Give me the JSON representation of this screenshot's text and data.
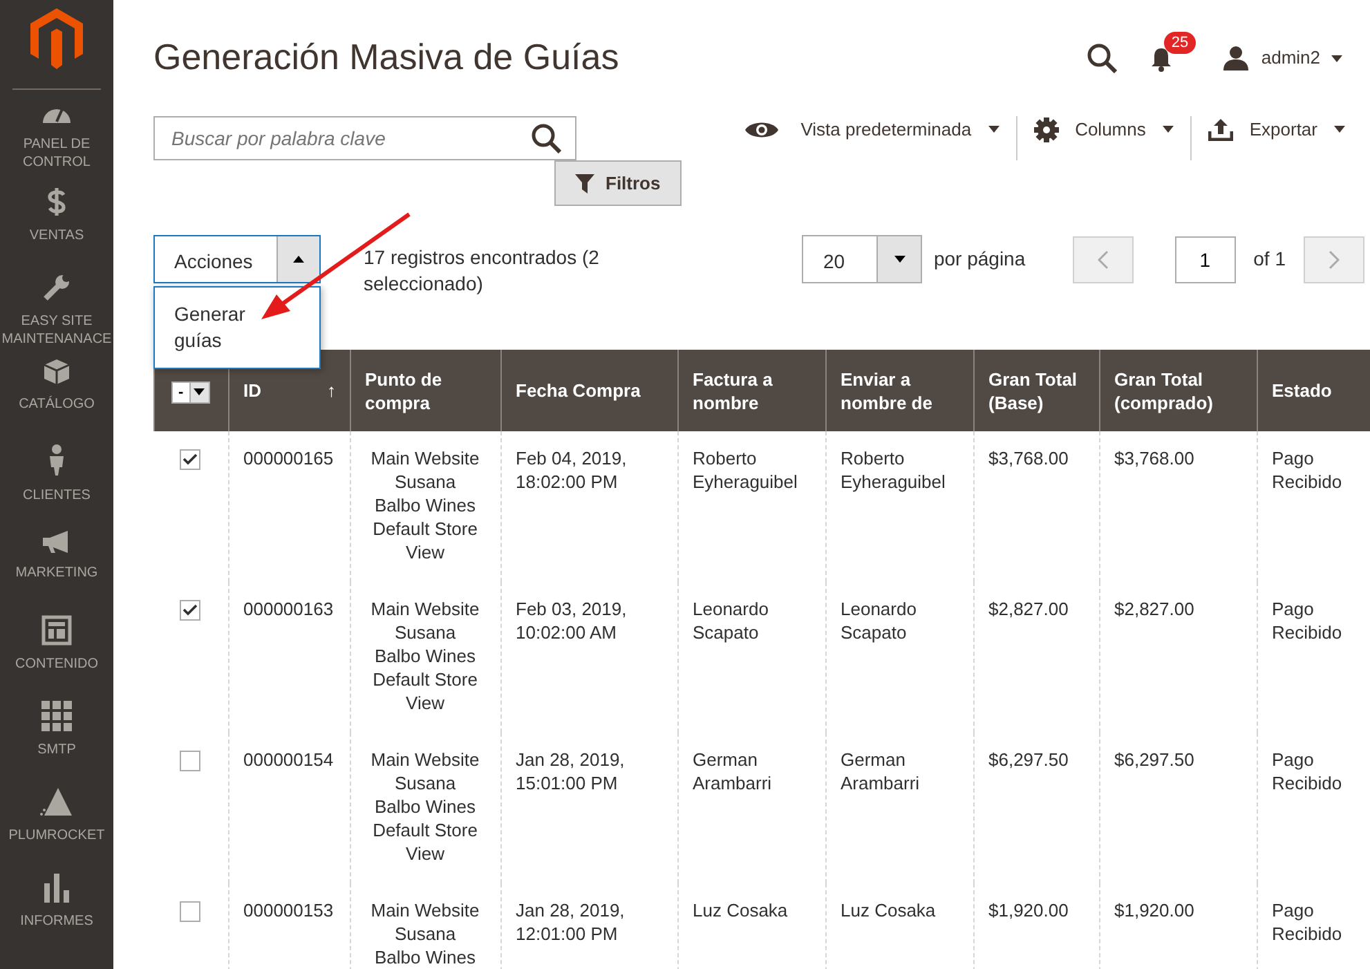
{
  "sidebar": {
    "items": [
      {
        "label": "PANEL DE CONTROL"
      },
      {
        "label": "VENTAS"
      },
      {
        "label": "EASY SITE MAINTENANACE"
      },
      {
        "label": "CATÁLOGO"
      },
      {
        "label": "CLIENTES"
      },
      {
        "label": "MARKETING"
      },
      {
        "label": "CONTENIDO"
      },
      {
        "label": "SMTP"
      },
      {
        "label": "PLUMROCKET"
      },
      {
        "label": "INFORMES"
      }
    ]
  },
  "header": {
    "title": "Generación Masiva de Guías",
    "notifications": "25",
    "user": "admin2"
  },
  "search": {
    "placeholder": "Buscar por palabra clave"
  },
  "toolbar": {
    "view": "Vista predeterminada",
    "columns": "Columns",
    "export": "Exportar",
    "filters": "Filtros"
  },
  "actions": {
    "label": "Acciones",
    "expanded": true,
    "menu": [
      "Generar guías"
    ]
  },
  "records": "17 registros encontrados (2 seleccionado)",
  "pager": {
    "per_page": "20",
    "per_page_label": "por página",
    "page": "1",
    "of": "of 1"
  },
  "table": {
    "mass_select": "-",
    "columns": [
      {
        "label": "ID",
        "sort_mark": "↑"
      },
      {
        "label": "Punto de compra"
      },
      {
        "label": "Fecha Compra"
      },
      {
        "label": "Factura a nombre"
      },
      {
        "label": "Enviar a nombre de"
      },
      {
        "label": "Gran Total (Base)"
      },
      {
        "label": "Gran Total (comprado)"
      },
      {
        "label": "Estado"
      }
    ],
    "rows": [
      {
        "selected": true,
        "cells": [
          "000000165",
          "Main Website Susana Balbo Wines Default Store View",
          "Feb 04, 2019, 18:02:00 PM",
          "Roberto Eyheraguibel",
          "Roberto Eyheraguibel",
          "$3,768.00",
          "$3,768.00",
          "Pago Recibido"
        ]
      },
      {
        "selected": true,
        "cells": [
          "000000163",
          "Main Website Susana Balbo Wines Default Store View",
          "Feb 03, 2019, 10:02:00 AM",
          "Leonardo Scapato",
          "Leonardo Scapato",
          "$2,827.00",
          "$2,827.00",
          "Pago Recibido"
        ]
      },
      {
        "selected": false,
        "cells": [
          "000000154",
          "Main Website Susana Balbo Wines Default Store View",
          "Jan 28, 2019, 15:01:00 PM",
          "German Arambarri",
          "German Arambarri",
          "$6,297.50",
          "$6,297.50",
          "Pago Recibido"
        ]
      },
      {
        "selected": false,
        "cells": [
          "000000153",
          "Main Website Susana Balbo Wines",
          "Jan 28, 2019, 12:01:00 PM",
          "Luz Cosaka",
          "Luz Cosaka",
          "$1,920.00",
          "$1,920.00",
          "Pago Recibido"
        ]
      }
    ]
  }
}
